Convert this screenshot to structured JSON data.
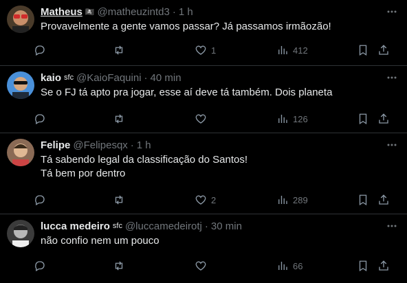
{
  "tweets": [
    {
      "name": "Matheus",
      "badge": "🏴‍☠️",
      "handle": "@matheuzintd3",
      "time": "1 h",
      "lines": [
        "Provavelmente a gente vamos passar? Já passamos irmãozão!"
      ],
      "likes": "1",
      "views": "412",
      "avatar_color": "#c0392b"
    },
    {
      "name": "kaio",
      "badge": "sfc",
      "handle": "@KaioFaquini",
      "time": "40 min",
      "lines": [
        "Se o FJ tá apto pra jogar, esse aí deve tá também. Dois planeta"
      ],
      "likes": "",
      "views": "126",
      "avatar_color": "#3a8fd8"
    },
    {
      "name": "Felipe",
      "badge": "",
      "handle": "@Felipesqx",
      "time": "1 h",
      "lines": [
        "Tá sabendo legal da classificação do Santos!",
        "Tá bem por dentro"
      ],
      "likes": "2",
      "views": "289",
      "avatar_color": "#b08a6a"
    },
    {
      "name": "lucca medeiro",
      "badge": "sfc",
      "handle": "@luccamedeirotj",
      "time": "30 min",
      "lines": [
        "não confio nem um pouco"
      ],
      "likes": "",
      "views": "66",
      "avatar_color": "#6b6b6b"
    }
  ]
}
